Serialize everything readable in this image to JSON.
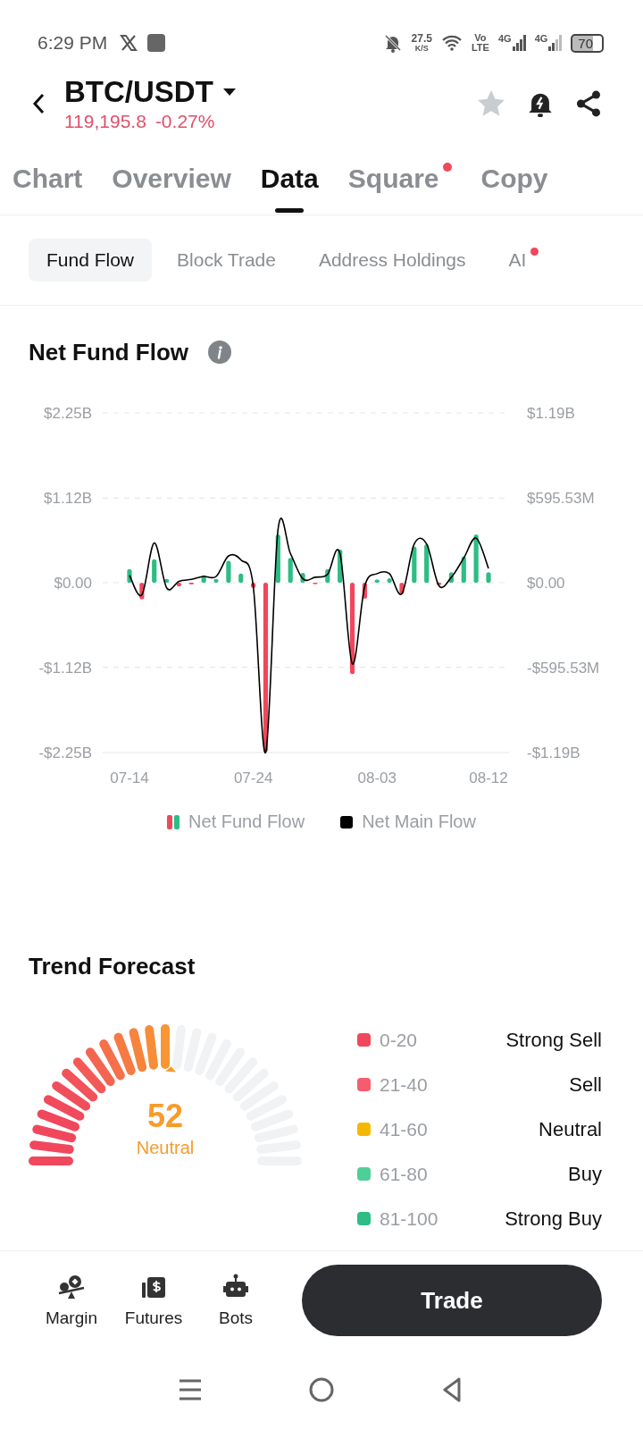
{
  "status_bar": {
    "time": "6:29 PM",
    "speed": "27.5",
    "speed_unit": "K/S",
    "volte_top": "Vo",
    "volte_bottom": "LTE",
    "network_1": "4G",
    "network_2": "4G",
    "battery": "70"
  },
  "header": {
    "pair": "BTC/USDT",
    "price": "119,195.8",
    "change": "-0.27%"
  },
  "tabs": [
    {
      "label": "Chart",
      "selected": false,
      "dot": false
    },
    {
      "label": "Overview",
      "selected": false,
      "dot": false
    },
    {
      "label": "Data",
      "selected": true,
      "dot": false
    },
    {
      "label": "Square",
      "selected": false,
      "dot": true
    },
    {
      "label": "Copy",
      "selected": false,
      "dot": false
    }
  ],
  "subtabs": [
    {
      "label": "Fund Flow",
      "selected": true,
      "dot": false
    },
    {
      "label": "Block Trade",
      "selected": false,
      "dot": false
    },
    {
      "label": "Address Holdings",
      "selected": false,
      "dot": false
    },
    {
      "label": "AI",
      "selected": false,
      "dot": true
    }
  ],
  "fund_flow": {
    "title": "Net Fund Flow",
    "chart_data": {
      "type": "bar",
      "categories": [
        "07-14",
        null,
        null,
        null,
        null,
        null,
        null,
        null,
        null,
        null,
        "07-24",
        null,
        null,
        null,
        null,
        null,
        null,
        null,
        null,
        null,
        "08-03",
        null,
        null,
        null,
        null,
        null,
        null,
        null,
        null,
        "08-12"
      ],
      "grid": true,
      "series": [
        {
          "name": "Net Fund Flow",
          "color": "#2dbd85",
          "values": [
            0.18,
            null,
            0.31,
            0.05,
            null,
            null,
            0.1,
            0.05,
            0.29,
            0.12,
            null,
            null,
            0.64,
            0.33,
            0.13,
            null,
            0.18,
            0.44,
            null,
            null,
            0.04,
            0.06,
            null,
            0.48,
            0.51,
            null,
            0.14,
            0.35,
            0.64,
            0.14
          ]
        },
        {
          "color": "#f0475d",
          "values": [
            null,
            -0.22,
            null,
            null,
            -0.05,
            -0.02,
            null,
            null,
            null,
            null,
            -0.07,
            -2.24,
            null,
            null,
            null,
            -0.01,
            null,
            null,
            -1.21,
            -0.21,
            null,
            null,
            -0.15,
            null,
            null,
            -0.03,
            null,
            null,
            null,
            null
          ]
        },
        {
          "name": "Net Main Flow",
          "type": "line",
          "color": "#000000",
          "axis": "y2",
          "values": [
            52000000,
            -84000000,
            278000000,
            -36000000,
            10000000,
            23000000,
            44000000,
            44000000,
            188000000,
            159000000,
            -25000000,
            -1190000000,
            372000000,
            205000000,
            27000000,
            38000000,
            59000000,
            205000000,
            -568000000,
            -25000000,
            63000000,
            63000000,
            -77000000,
            272000000,
            272000000,
            -21000000,
            38000000,
            173000000,
            313000000,
            100000000
          ]
        }
      ],
      "ylim": [
        -2.25,
        2.25
      ],
      "yticks": [
        {
          "value": 2.25,
          "label": "$2.25B"
        },
        {
          "value": 1.12,
          "label": "$1.12B"
        },
        {
          "value": 0,
          "label": "$0.00"
        },
        {
          "value": -1.12,
          "label": "-$1.12B"
        },
        {
          "value": -2.25,
          "label": "-$2.25B"
        }
      ],
      "y2lim": [
        -1190000000,
        1190000000
      ],
      "y2ticks": [
        {
          "value": 1190000000,
          "label": "$1.19B"
        },
        {
          "value": 595530000,
          "label": "$595.53M"
        },
        {
          "value": 0,
          "label": "$0.00"
        },
        {
          "value": -595530000,
          "label": "-$595.53M"
        },
        {
          "value": -1190000000,
          "label": "-$1.19B"
        }
      ]
    }
  },
  "trend_forecast": {
    "title": "Trend Forecast",
    "gauge": {
      "value": "52",
      "label": "Neutral"
    },
    "legend": [
      {
        "range": "0-20",
        "label": "Strong Sell",
        "color": "#f0475d"
      },
      {
        "range": "21-40",
        "label": "Sell",
        "color": "#f55d6e"
      },
      {
        "range": "41-60",
        "label": "Neutral",
        "color": "#f5b800"
      },
      {
        "range": "61-80",
        "label": "Buy",
        "color": "#4fcf98"
      },
      {
        "range": "81-100",
        "label": "Strong Buy",
        "color": "#2dbd85"
      }
    ]
  },
  "bottom_bar": {
    "items": [
      {
        "kind": "margin",
        "label": "Margin"
      },
      {
        "kind": "futures",
        "label": "Futures"
      },
      {
        "kind": "bots",
        "label": "Bots"
      }
    ],
    "trade_button": "Trade"
  }
}
